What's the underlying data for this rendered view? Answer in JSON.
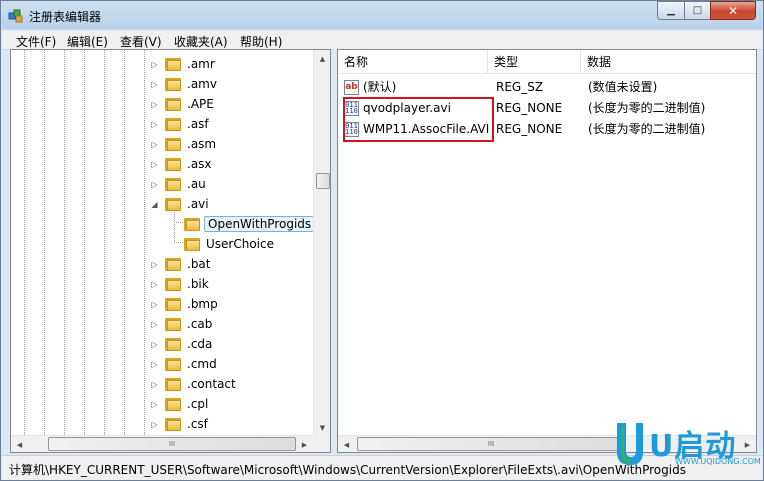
{
  "window": {
    "title": "注册表编辑器",
    "min_glyph": "▁",
    "max_glyph": "□",
    "close_glyph": "✕"
  },
  "menu": [
    {
      "label": "文件(F)"
    },
    {
      "label": "编辑(E)"
    },
    {
      "label": "查看(V)"
    },
    {
      "label": "收藏夹(A)"
    },
    {
      "label": "帮助(H)"
    }
  ],
  "tree": {
    "items": [
      {
        "label": ".amr",
        "expander": "▷"
      },
      {
        "label": ".amv",
        "expander": "▷"
      },
      {
        "label": ".APE",
        "expander": "▷"
      },
      {
        "label": ".asf",
        "expander": "▷"
      },
      {
        "label": ".asm",
        "expander": "▷"
      },
      {
        "label": ".asx",
        "expander": "▷"
      },
      {
        "label": ".au",
        "expander": "▷"
      },
      {
        "label": ".avi",
        "expander": "◢"
      },
      {
        "label": "OpenWithProgids",
        "expander": "",
        "selected": true
      },
      {
        "label": "UserChoice",
        "expander": ""
      },
      {
        "label": ".bat",
        "expander": "▷"
      },
      {
        "label": ".bik",
        "expander": "▷"
      },
      {
        "label": ".bmp",
        "expander": "▷"
      },
      {
        "label": ".cab",
        "expander": "▷"
      },
      {
        "label": ".cda",
        "expander": "▷"
      },
      {
        "label": ".cmd",
        "expander": "▷"
      },
      {
        "label": ".contact",
        "expander": "▷"
      },
      {
        "label": ".cpl",
        "expander": "▷"
      },
      {
        "label": ".csf",
        "expander": "▷"
      }
    ]
  },
  "list": {
    "columns": [
      "名称",
      "类型",
      "数据"
    ],
    "rows": [
      {
        "name": "(默认)",
        "type": "REG_SZ",
        "data": "(数值未设置)",
        "icon": "string-value-icon",
        "icon_text": "ab"
      },
      {
        "name": "qvodplayer.avi",
        "type": "REG_NONE",
        "data": "(长度为零的二进制值)",
        "icon": "binary-value-icon",
        "icon_text": "011\n110"
      },
      {
        "name": "WMP11.AssocFile.AVI",
        "type": "REG_NONE",
        "data": "(长度为零的二进制值)",
        "icon": "binary-value-icon",
        "icon_text": "011\n110"
      }
    ]
  },
  "scroll": {
    "up": "▲",
    "down": "▼",
    "left": "◀",
    "right": "▶",
    "grip": "III"
  },
  "statusbar": {
    "path": "计算机\\HKEY_CURRENT_USER\\Software\\Microsoft\\Windows\\CurrentVersion\\Explorer\\FileExts\\.avi\\OpenWithProgids"
  },
  "logo": {
    "text": "U启动",
    "url": "WWW.UQIDONG.COM"
  },
  "colors": {
    "highlight_box": "#d3131c",
    "selection_bg": "#e5f3fb",
    "logo": "#1d9ad8"
  }
}
